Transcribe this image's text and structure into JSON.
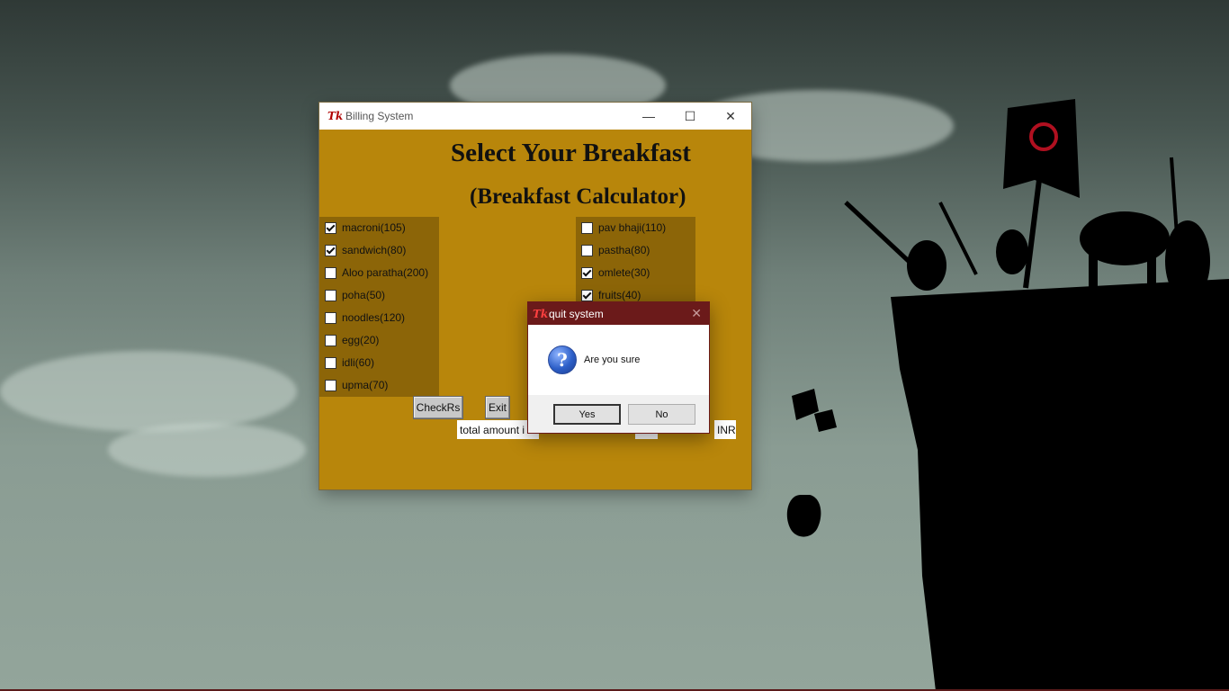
{
  "window": {
    "title": "Billing System",
    "minimize_glyph": "—",
    "maximize_glyph": "☐",
    "close_glyph": "✕"
  },
  "header": {
    "title": "Select Your Breakfast",
    "subtitle": "(Breakfast Calculator)"
  },
  "left_items": [
    {
      "label": "macroni(105)",
      "checked": true
    },
    {
      "label": "sandwich(80)",
      "checked": true
    },
    {
      "label": "Aloo paratha(200)",
      "checked": false
    },
    {
      "label": "poha(50)",
      "checked": false
    },
    {
      "label": "noodles(120)",
      "checked": false
    },
    {
      "label": "egg(20)",
      "checked": false
    },
    {
      "label": "idli(60)",
      "checked": false
    },
    {
      "label": "upma(70)",
      "checked": false
    }
  ],
  "right_items": [
    {
      "label": "pav bhaji(110)",
      "checked": false
    },
    {
      "label": "pastha(80)",
      "checked": false
    },
    {
      "label": "omlete(30)",
      "checked": true
    },
    {
      "label": "fruits(40)",
      "checked": true
    }
  ],
  "buttons": {
    "check": "CheckRs",
    "exit": "Exit"
  },
  "total": {
    "label": "total amount i",
    "currency": "INR"
  },
  "dialog": {
    "title": "quit system",
    "message": "Are you sure",
    "yes": "Yes",
    "no": "No",
    "icon_glyph": "?",
    "close_glyph": "✕"
  },
  "colors": {
    "window_bg": "#b8860b",
    "panel_bg": "#8c6508",
    "dialog_title_bg": "#6b1a1a"
  }
}
